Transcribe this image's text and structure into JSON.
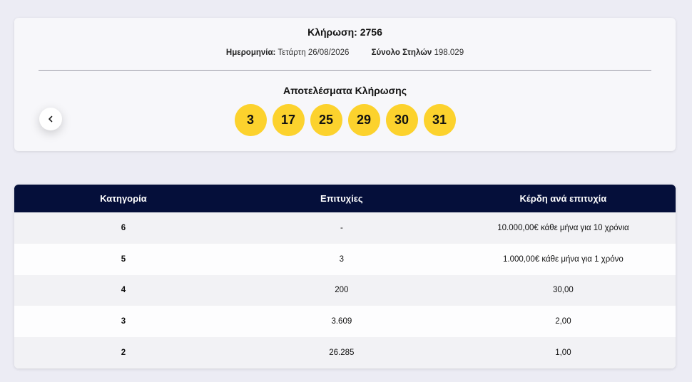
{
  "draw": {
    "title": "Κλήρωση: 2756",
    "date_label": "Ημερομηνία:",
    "date_value": "Τετάρτη 26/08/2026",
    "columns_label": "Σύνολο Στηλών",
    "columns_value": "198.029",
    "results_title": "Αποτελέσματα Κλήρωσης",
    "numbers": [
      "3",
      "17",
      "25",
      "29",
      "30",
      "31"
    ],
    "ball_color": "#fcd22d",
    "prev_icon": "chevron-left-icon"
  },
  "table": {
    "header_color": "#050f3a",
    "headers": [
      "Κατηγορία",
      "Επιτυχίες",
      "Κέρδη ανά επιτυχία"
    ],
    "rows": [
      [
        "6",
        "-",
        "10.000,00€ κάθε μήνα για 10 χρόνια"
      ],
      [
        "5",
        "3",
        "1.000,00€ κάθε μήνα για 1 χρόνο"
      ],
      [
        "4",
        "200",
        "30,00"
      ],
      [
        "3",
        "3.609",
        "2,00"
      ],
      [
        "2",
        "26.285",
        "1,00"
      ]
    ]
  }
}
